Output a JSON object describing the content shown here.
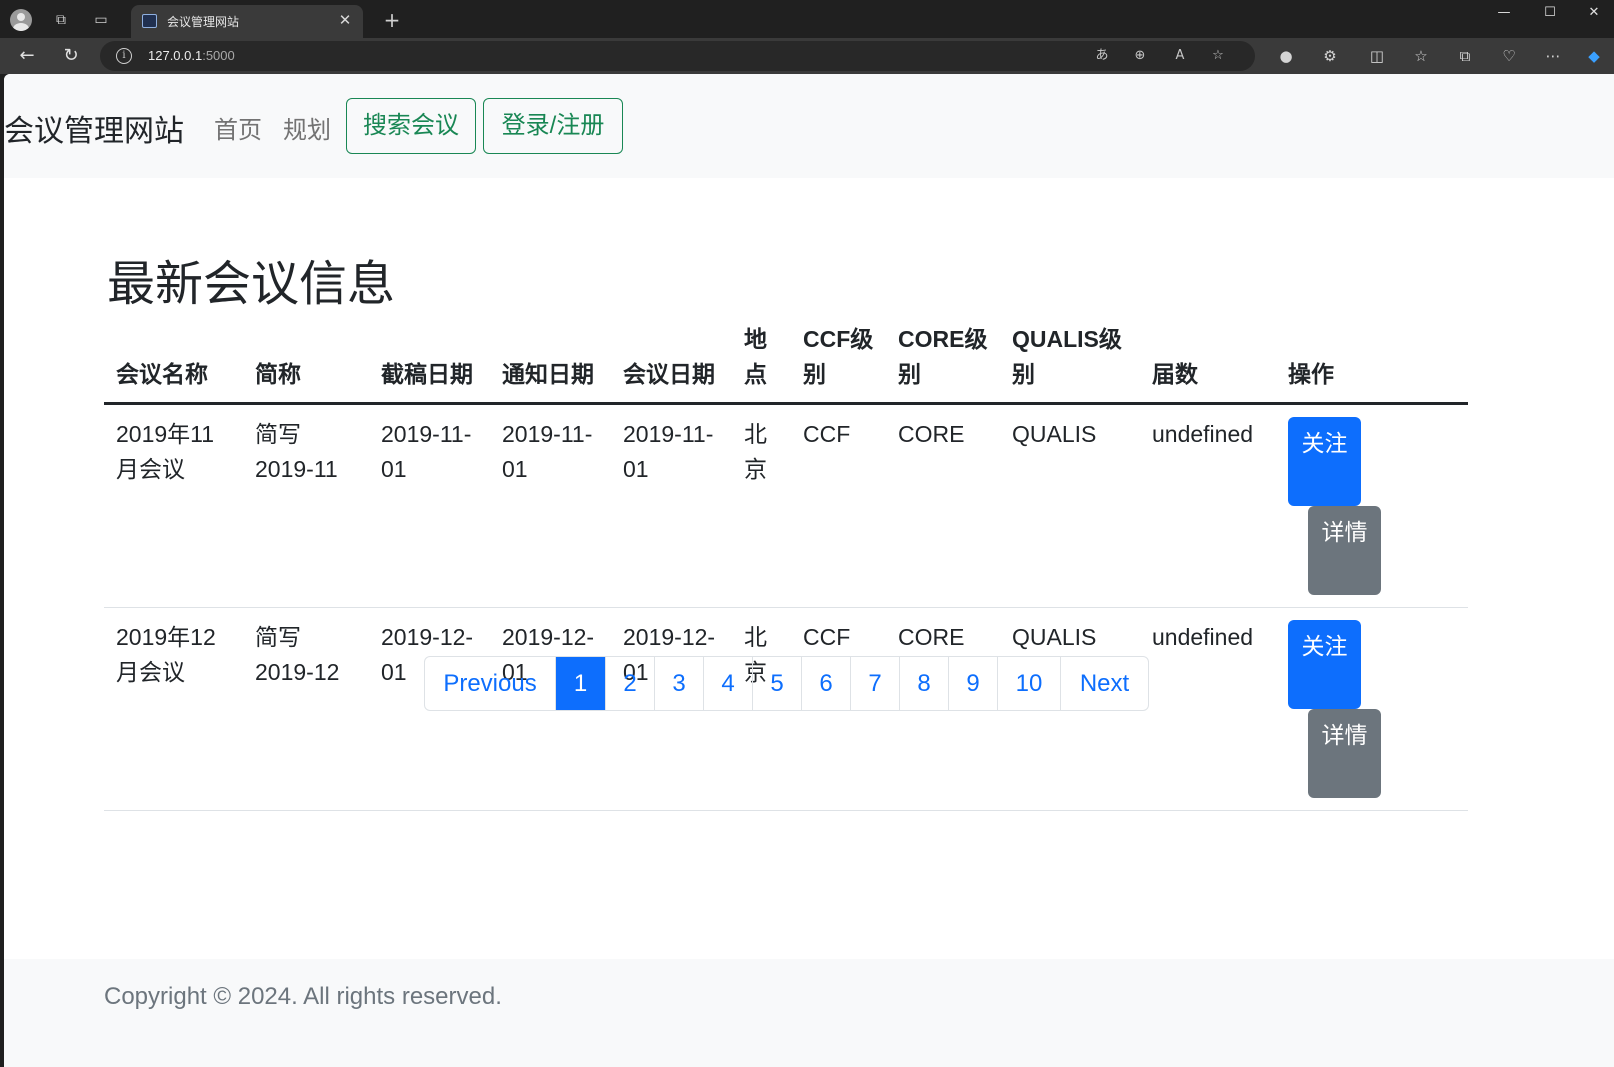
{
  "browser": {
    "tab_title": "会议管理网站",
    "new_tab_symbol": "+",
    "url_host": "127.0.0.1",
    "url_port": ":5000"
  },
  "navbar": {
    "brand": "会议管理网站",
    "links": [
      "首页",
      "规划"
    ],
    "search_button": "搜索会议",
    "login_button": "登录/注册"
  },
  "main": {
    "title": "最新会议信息",
    "table": {
      "headers": [
        "会议名称",
        "简称",
        "截稿日期",
        "通知日期",
        "会议日期",
        "地点",
        "CCF级别",
        "CORE级别",
        "QUALIS级别",
        "届数",
        "操作"
      ],
      "rows": [
        {
          "name": "2019年11月会议",
          "abbr": "简写2019-11",
          "deadline": "2019-11-01",
          "notice": "2019-11-01",
          "date": "2019-11-01",
          "location": "北京",
          "ccf": "CCF",
          "core": "CORE",
          "qualis": "QUALIS",
          "session": "undefined",
          "follow": "关注",
          "detail": "详情"
        },
        {
          "name": "2019年12月会议",
          "abbr": "简写2019-12",
          "deadline": "2019-12-01",
          "notice": "2019-12-01",
          "date": "2019-12-01",
          "location": "北京",
          "ccf": "CCF",
          "core": "CORE",
          "qualis": "QUALIS",
          "session": "undefined",
          "follow": "关注",
          "detail": "详情"
        }
      ]
    },
    "pagination": {
      "previous": "Previous",
      "pages": [
        "1",
        "2",
        "3",
        "4",
        "5",
        "6",
        "7",
        "8",
        "9",
        "10"
      ],
      "active_page": "1",
      "next": "Next"
    }
  },
  "footer": {
    "copyright": "Copyright © 2024. All rights reserved."
  },
  "colors": {
    "primary": "#0d6efd",
    "success": "#198754",
    "secondary": "#6c757d"
  }
}
